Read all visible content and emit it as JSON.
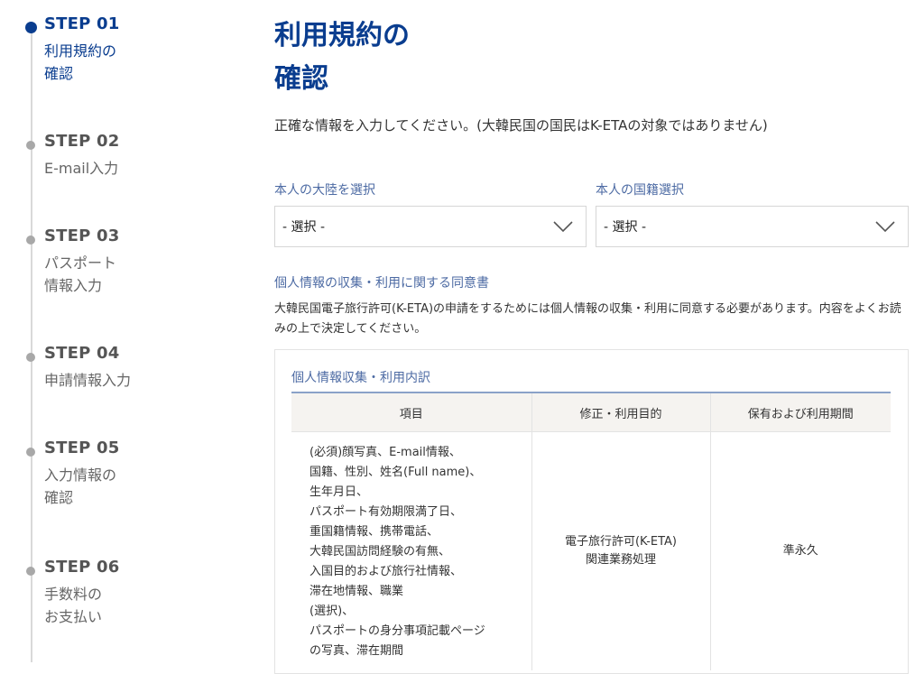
{
  "steps": [
    {
      "num": "STEP 01",
      "title_lines": [
        "利用規約の",
        "確認"
      ],
      "active": true
    },
    {
      "num": "STEP 02",
      "title_lines": [
        "E-mail入力"
      ],
      "active": false
    },
    {
      "num": "STEP 03",
      "title_lines": [
        "パスポート",
        "情報入力"
      ],
      "active": false
    },
    {
      "num": "STEP 04",
      "title_lines": [
        "申請情報入力"
      ],
      "active": false
    },
    {
      "num": "STEP 05",
      "title_lines": [
        "入力情報の",
        "確認"
      ],
      "active": false
    },
    {
      "num": "STEP 06",
      "title_lines": [
        "手数料の",
        "お支払い"
      ],
      "active": false
    }
  ],
  "page": {
    "title_line1": "利用規約の",
    "title_line2": "確認",
    "description": "正確な情報を入力してください。(大韓民国の国民はK-ETAの対象ではありません)"
  },
  "continent": {
    "label": "本人の大陸を選択",
    "value": "- 選択 -"
  },
  "nationality": {
    "label": "本人の国籍選択",
    "value": "- 選択 -"
  },
  "consent": {
    "title": "個人情報の収集・利用に関する同意書",
    "description": "大韓民国電子旅行許可(K-ETA)の申請をするためには個人情報の収集・利用に同意する必要があります。内容をよくお読みの上で決定してください。",
    "box_title": "個人情報収集・利用内訳",
    "table": {
      "headers": [
        "項目",
        "修正・利用目的",
        "保有および利用期間"
      ],
      "items": [
        "(必須)顔写真、E-mail情報、",
        "国籍、性別、姓名(Full name)、",
        "生年月日、",
        "パスポート有効期限満了日、",
        "重国籍情報、携帯電話、",
        "大韓民国訪問経験の有無、",
        "入国目的および旅行社情報、",
        "滞在地情報、職業",
        "(選択)、",
        "パスポートの身分事項記載ページ",
        "の写真、滞在期間"
      ],
      "purpose_lines": [
        "電子旅行許可(K-ETA)",
        "関連業務処理"
      ],
      "period": "準永久"
    }
  },
  "colors": {
    "accent": "#0a3d8f",
    "label": "#4c6aa3",
    "inactive": "#a8a8a8"
  },
  "icons": {
    "select_chevron": "chevron-down-icon",
    "step_marker": "step-dot-icon"
  }
}
